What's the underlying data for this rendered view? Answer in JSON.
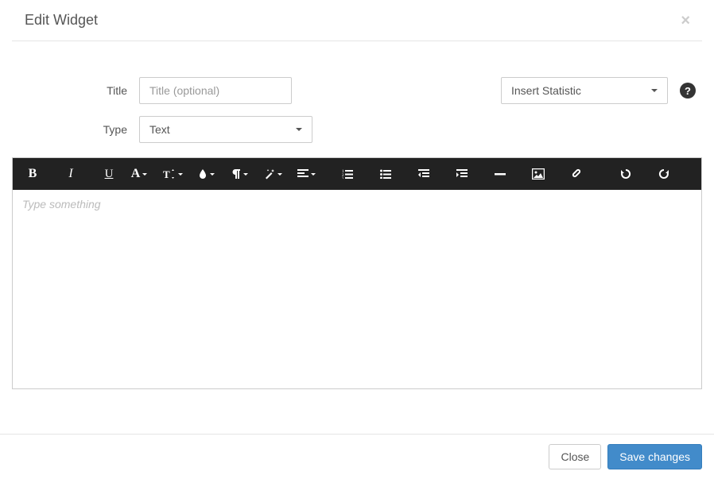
{
  "header": {
    "title": "Edit Widget"
  },
  "form": {
    "title_label": "Title",
    "title_placeholder": "Title (optional)",
    "title_value": "",
    "type_label": "Type",
    "type_value": "Text",
    "statistic_value": "Insert Statistic"
  },
  "editor": {
    "placeholder": "Type something"
  },
  "footer": {
    "close": "Close",
    "save": "Save changes"
  }
}
